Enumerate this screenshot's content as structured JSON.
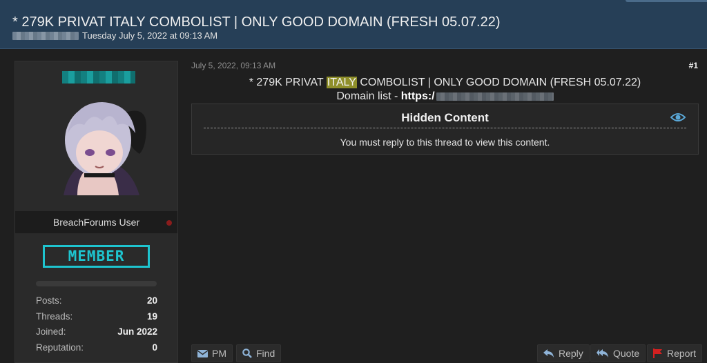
{
  "header": {
    "title": "* 279K PRIVAT ITALY COMBOLIST | ONLY GOOD DOMAIN (FRESH 05.07.22)",
    "date": "Tuesday July 5, 2022 at 09:13 AM"
  },
  "author": {
    "username": "BreachForums User",
    "rank": "MEMBER",
    "stats": [
      {
        "label": "Posts:",
        "value": "20"
      },
      {
        "label": "Threads:",
        "value": "19"
      },
      {
        "label": "Joined:",
        "value": "Jun 2022"
      },
      {
        "label": "Reputation:",
        "value": "0"
      }
    ]
  },
  "post": {
    "date": "July 5, 2022, 09:13 AM",
    "number": "#1",
    "line1_pre": "* 279K PRIVAT ",
    "line1_highlight": "ITALY",
    "line1_post": " COMBOLIST | ONLY GOOD DOMAIN (FRESH 05.07.22)",
    "line2_label": "Domain list - ",
    "line2_link": "https:/",
    "hidden_title": "Hidden Content",
    "hidden_message": "You must reply to this thread to view this content."
  },
  "actions": {
    "pm": "PM",
    "find": "Find",
    "reply": "Reply",
    "quote": "Quote",
    "report": "Report"
  },
  "colors": {
    "header_bg": "#263f57",
    "rank_accent": "#1ec4cf",
    "highlight": "#8f8f2a",
    "report_flag": "#d42020",
    "eye_icon": "#5aa8d8"
  }
}
